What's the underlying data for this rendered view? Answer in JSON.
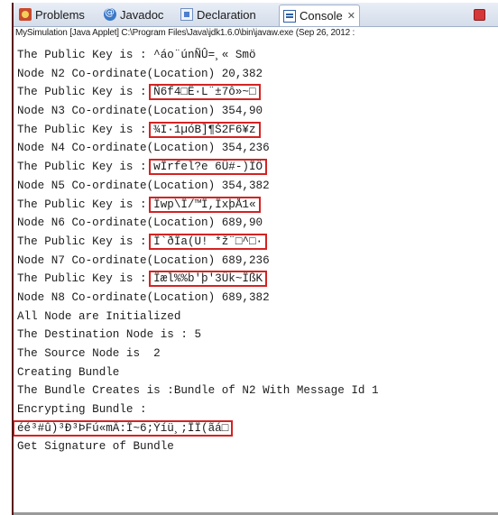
{
  "tabs": [
    {
      "label": "Problems",
      "icon": "problems-icon"
    },
    {
      "label": "Javadoc",
      "icon": "javadoc-icon"
    },
    {
      "label": "Declaration",
      "icon": "declaration-icon"
    },
    {
      "label": "Console",
      "icon": "console-icon",
      "close": "✕"
    }
  ],
  "subtitle": "MySimulation [Java Applet] C:\\Program Files\\Java\\jdk1.6.0\\bin\\javaw.exe (Sep 26, 2012 :",
  "console_lines": [
    {
      "prefix": "The Public Key is : ",
      "value": "^áo¨únÑÛ=¸« Smö",
      "boxed": false
    },
    {
      "prefix": "Node N2 Co-ordinate(Location) 20,382",
      "value": "",
      "boxed": false
    },
    {
      "prefix": "The Public Key is : ",
      "value": "Ñ6f4□Ê·L¨±7ô»~□",
      "boxed": true
    },
    {
      "prefix": "Node N3 Co-ordinate(Location) 354,90",
      "value": "",
      "boxed": false
    },
    {
      "prefix": "The Public Key is : ",
      "value": "¾I·1µóB]¶Š2F6¥z",
      "boxed": true
    },
    {
      "prefix": "Node N4 Co-ordinate(Location) 354,236",
      "value": "",
      "boxed": false
    },
    {
      "prefix": "The Public Key is : ",
      "value": "wÎrfel?e¯6Û#-)ÎÖ",
      "boxed": true
    },
    {
      "prefix": "Node N5 Co-ordinate(Location) 354,382",
      "value": "",
      "boxed": false
    },
    {
      "prefix": "The Public Key is : ",
      "value": "Ïwp\\Î/™Î,ÎxþÅ1«",
      "boxed": true
    },
    {
      "prefix": "Node N6 Co-ordinate(Location) 689,90",
      "value": "",
      "boxed": false
    },
    {
      "prefix": "The Public Key is : ",
      "value": "Î`ðÎa(U!¯*ž¨□^□·",
      "boxed": true
    },
    {
      "prefix": "Node N7 Co-ordinate(Location) 689,236",
      "value": "",
      "boxed": false
    },
    {
      "prefix": "The Public Key is : ",
      "value": "Îæl%%b'þ'3Ük~ÎßK",
      "boxed": true
    },
    {
      "prefix": "Node N8 Co-ordinate(Location) 689,382",
      "value": "",
      "boxed": false
    },
    {
      "prefix": "All Node are Initialized",
      "value": "",
      "boxed": false
    },
    {
      "prefix": "The Destination Node is : 5",
      "value": "",
      "boxed": false
    },
    {
      "prefix": "The Source Node is  2",
      "value": "",
      "boxed": false
    },
    {
      "prefix": "Creating Bundle",
      "value": "",
      "boxed": false
    },
    {
      "prefix": "The Bundle Creates is :Bundle of N2 With Message Id 1",
      "value": "",
      "boxed": false
    },
    {
      "prefix": "Encrypting Bundle :",
      "value": "",
      "boxed": false
    },
    {
      "prefix": "",
      "value": "éé³#û)³Ð³ÞFú«mÄ:Î~6;Ýíü¸;ÎÏ(ãá□",
      "boxed": true
    },
    {
      "prefix": "Get Signature of Bundle",
      "value": "",
      "boxed": false
    }
  ],
  "colors": {
    "highlight_box": "#d42323",
    "frame_border": "#5a1212"
  }
}
